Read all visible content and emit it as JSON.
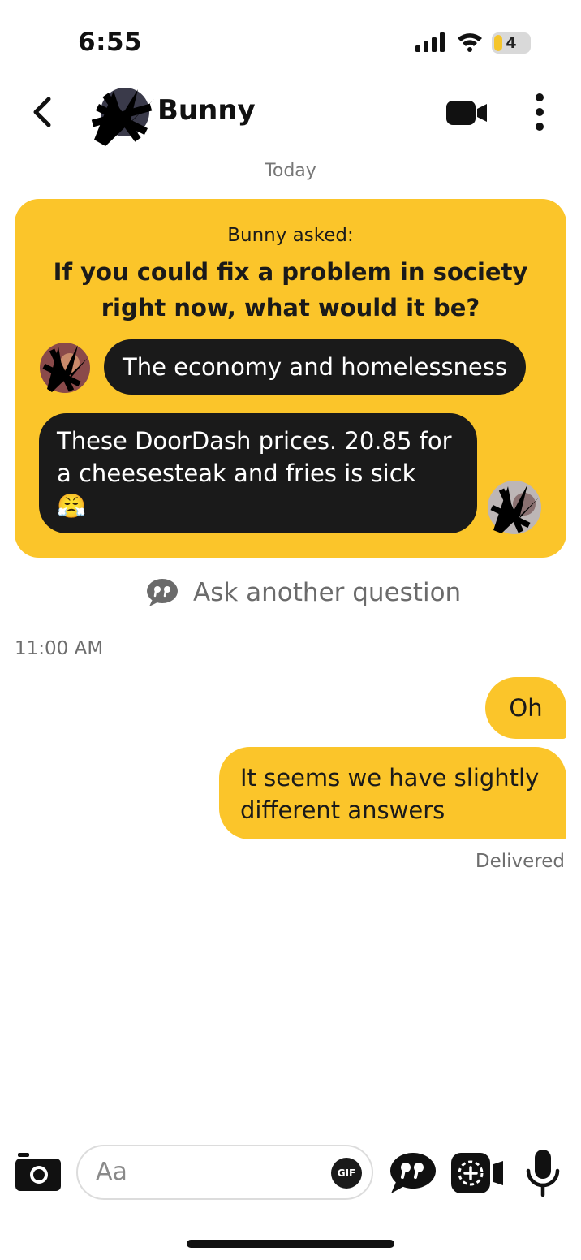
{
  "status_bar": {
    "time": "6:55",
    "battery_level": "4",
    "icons": [
      "signal-icon",
      "wifi-icon",
      "battery-icon"
    ]
  },
  "header": {
    "contact_name": "Bunny",
    "icons": [
      "back-icon",
      "video-call-icon",
      "more-vertical-icon"
    ]
  },
  "conversation": {
    "date_label": "Today",
    "question_card": {
      "asked_by": "Bunny asked:",
      "question": "If you could fix a problem in society right now, what would it be?",
      "answers": [
        {
          "text": "The economy and homelessness"
        },
        {
          "text": "These DoorDash prices. 20.85 for a  cheesesteak and fries is sick",
          "emoji": "😤"
        }
      ]
    },
    "ask_another_label": "Ask another question",
    "timestamp": "11:00 AM",
    "messages": [
      {
        "text": "Oh"
      },
      {
        "text": "It seems we have slightly different answers"
      }
    ],
    "delivered_label": "Delivered"
  },
  "composer": {
    "placeholder": "Aa",
    "gif_label": "GIF",
    "icons": [
      "camera-icon",
      "question-game-icon",
      "video-note-icon",
      "microphone-icon"
    ]
  },
  "colors": {
    "accent": "#fbc52a",
    "dark_bubble": "#1a1a1a",
    "muted_text": "#6e6e6e"
  }
}
